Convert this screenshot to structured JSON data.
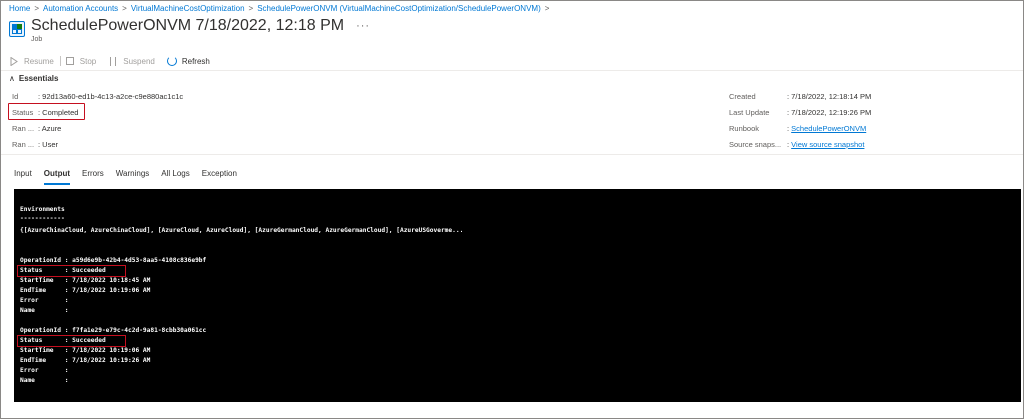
{
  "breadcrumb": [
    "Home",
    "Automation Accounts",
    "VirtualMachineCostOptimization",
    "SchedulePowerONVM (VirtualMachineCostOptimization/SchedulePowerONVM)"
  ],
  "header": {
    "title": "SchedulePowerONVM 7/18/2022, 12:18 PM",
    "subtitle": "Job",
    "more": "···"
  },
  "toolbar": {
    "resume": "Resume",
    "stop": "Stop",
    "suspend": "Suspend",
    "refresh": "Refresh"
  },
  "essentials": {
    "label": "Essentials",
    "left": [
      {
        "key": "Id",
        "value": "92d13a60-ed1b-4c13-a2ce-c9e880ac1c1c"
      },
      {
        "key": "Status",
        "value": "Completed"
      },
      {
        "key": "Ran ...",
        "value": "Azure"
      },
      {
        "key": "Ran ...",
        "value": "User"
      }
    ],
    "right": [
      {
        "key": "Created",
        "value": "7/18/2022, 12:18:14 PM"
      },
      {
        "key": "Last Update",
        "value": "7/18/2022, 12:19:26 PM"
      },
      {
        "key": "Runbook",
        "value": "SchedulePowerONVM"
      },
      {
        "key": "Source snaps...",
        "value": "View source snapshot"
      }
    ]
  },
  "tabs": [
    "Input",
    "Output",
    "Errors",
    "Warnings",
    "All Logs",
    "Exception"
  ],
  "console": {
    "lines": [
      "Environments",
      "------------",
      "{[AzureChinaCloud, AzureChinaCloud], [AzureCloud, AzureCloud], [AzureGermanCloud, AzureGermanCloud], [AzureUSGoverme...",
      "OperationId : a59d6e9b-42b4-4d53-8aa5-4108c836e9bf",
      "Status      : Succeeded",
      "StartTime   : 7/18/2022 10:18:45 AM",
      "EndTime     : 7/18/2022 10:19:06 AM",
      "Error       :",
      "Name        :",
      "OperationId : f7fa1e29-e79c-4c2d-9a81-8cbb30a061cc",
      "Status      : Succeeded",
      "StartTime   : 7/18/2022 10:19:06 AM",
      "EndTime     : 7/18/2022 10:19:26 AM",
      "Error       :",
      "Name        :"
    ]
  },
  "watermark": "MINDCORE",
  "colors": {
    "accent": "#0078d4",
    "highlight": "#c50f1f",
    "console_bg": "#000000"
  }
}
